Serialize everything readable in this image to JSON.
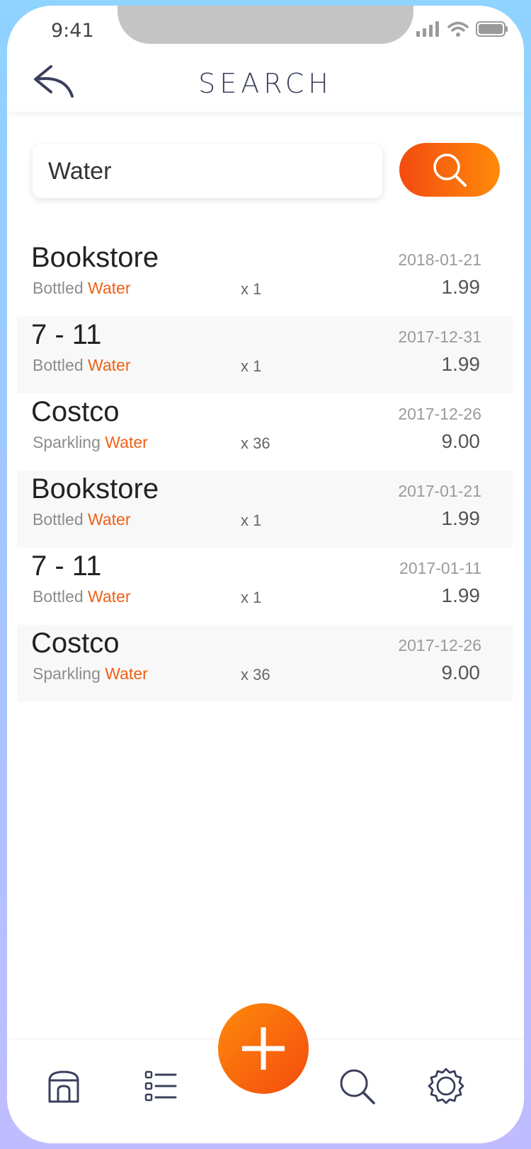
{
  "status_bar": {
    "time": "9:41"
  },
  "header": {
    "title": "SEARCH"
  },
  "search": {
    "value": "Water",
    "placeholder": ""
  },
  "results": [
    {
      "store": "Bookstore",
      "date": "2018-01-21",
      "item_prefix": "Bottled ",
      "keyword": "Water",
      "qty": "x 1",
      "price": "1.99"
    },
    {
      "store": "7 - 11",
      "date": "2017-12-31",
      "item_prefix": "Bottled ",
      "keyword": "Water",
      "qty": "x 1",
      "price": "1.99"
    },
    {
      "store": "Costco",
      "date": "2017-12-26",
      "item_prefix": "Sparkling ",
      "keyword": "Water",
      "qty": "x 36",
      "price": "9.00"
    },
    {
      "store": "Bookstore",
      "date": "2017-01-21",
      "item_prefix": "Bottled ",
      "keyword": "Water",
      "qty": "x 1",
      "price": "1.99"
    },
    {
      "store": "7 - 11",
      "date": "2017-01-11",
      "item_prefix": "Bottled ",
      "keyword": "Water",
      "qty": "x 1",
      "price": "1.99"
    },
    {
      "store": "Costco",
      "date": "2017-12-26",
      "item_prefix": "Sparkling ",
      "keyword": "Water",
      "qty": "x 36",
      "price": "9.00"
    }
  ],
  "nav": {
    "items": [
      "store-icon",
      "list-icon",
      "add-icon",
      "search-icon",
      "settings-icon"
    ]
  },
  "colors": {
    "accent": "#f34b0f",
    "accent_end": "#ff8a0a",
    "title": "#3a3f5c"
  }
}
